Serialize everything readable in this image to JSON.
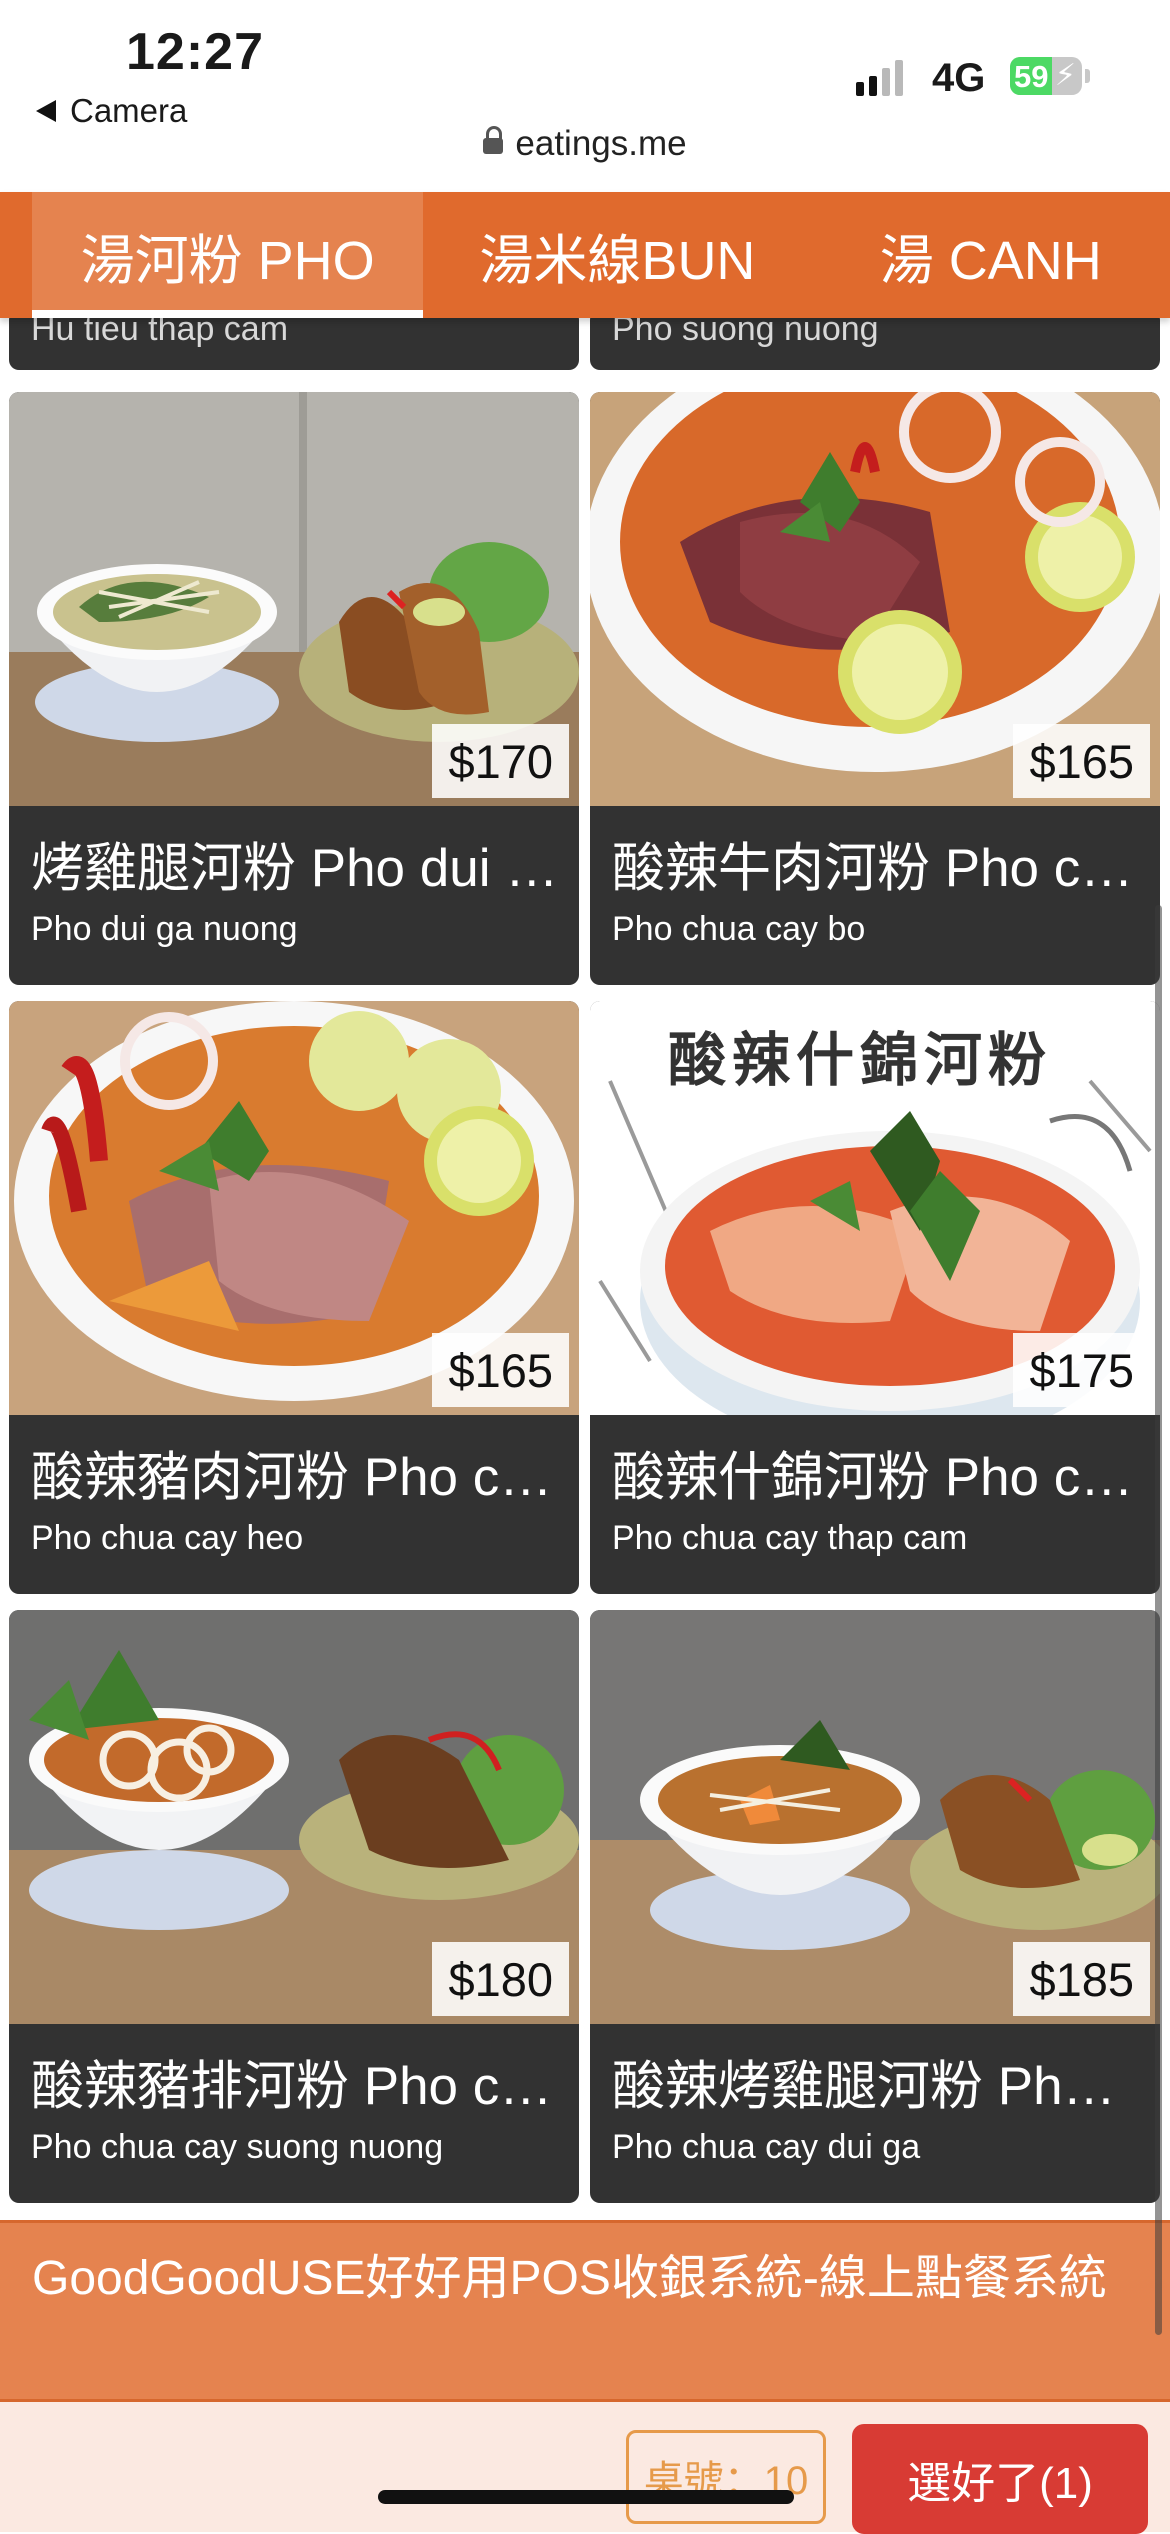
{
  "status_bar": {
    "time": "12:27",
    "back_label": "Camera",
    "network": "4G",
    "battery_percent": "59",
    "battery_level": 0.59,
    "url": "eatings.me"
  },
  "tabs": [
    {
      "label": "湯河粉 PHO",
      "active": true
    },
    {
      "label": "湯米線BUN",
      "active": false
    },
    {
      "label": "湯 CANH",
      "active": false
    }
  ],
  "partial_items": [
    {
      "subtitle": "Hu tieu thap cam"
    },
    {
      "subtitle": "Pho suong nuong"
    }
  ],
  "items": [
    {
      "title": "烤雞腿河粉 Pho dui ga nuong",
      "subtitle": "Pho dui ga nuong",
      "price": "$170",
      "photo": "chicken-pho"
    },
    {
      "title": "酸辣牛肉河粉 Pho chua cay bo",
      "subtitle": "Pho chua cay bo",
      "price": "$165",
      "photo": "spicy-beef-pho"
    },
    {
      "title": "酸辣豬肉河粉 Pho chua cay heo",
      "subtitle": "Pho chua cay heo",
      "price": "$165",
      "photo": "spicy-pork-pho"
    },
    {
      "title": "酸辣什錦河粉 Pho chua cay thap cam",
      "subtitle": "Pho chua cay thap cam",
      "price": "$175",
      "photo": "spicy-combo-pho",
      "photo_caption": "酸辣什錦河粉"
    },
    {
      "title": "酸辣豬排河粉 Pho chua cay suong nuong",
      "subtitle": "Pho chua cay suong nuong",
      "price": "$180",
      "photo": "spicy-porkchop-pho"
    },
    {
      "title": "酸辣烤雞腿河粉 Pho chua cay dui ga",
      "subtitle": "Pho chua cay dui ga",
      "price": "$185",
      "photo": "spicy-chicken-pho"
    }
  ],
  "banner": {
    "text": "GoodGoodUSE好好用POS收銀系統-線上點餐系統"
  },
  "footer": {
    "table_label": "桌號：10",
    "done_label": "選好了(1)"
  },
  "colors": {
    "accent": "#e06a2d",
    "tab_active": "#e5834f",
    "card_bg": "#323232",
    "button_red": "#d83b34"
  },
  "icons": [
    "back-triangle-icon",
    "lock-icon",
    "signal-icon",
    "battery-icon",
    "charging-bolt-icon"
  ]
}
